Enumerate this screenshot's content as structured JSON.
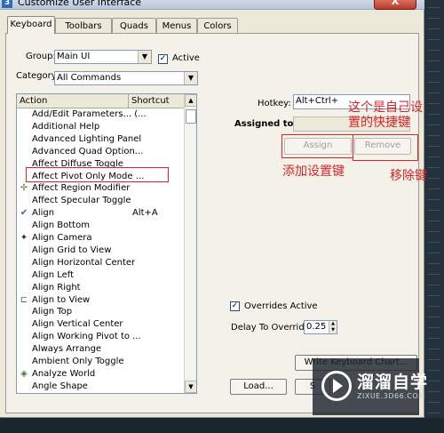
{
  "window": {
    "title": "Customize User Interface",
    "close_label": "X",
    "app_icon": "3ds-max-icon"
  },
  "tabs": [
    {
      "label": "Keyboard",
      "active": true
    },
    {
      "label": "Toolbars",
      "active": false
    },
    {
      "label": "Quads",
      "active": false
    },
    {
      "label": "Menus",
      "active": false
    },
    {
      "label": "Colors",
      "active": false
    }
  ],
  "group": {
    "label": "Group:",
    "value": "Main UI",
    "active_label": "Active",
    "active_checked": true
  },
  "category": {
    "label": "Category:",
    "value": "All Commands"
  },
  "list": {
    "col_action": "Action",
    "col_shortcut": "Shortcut",
    "rows": [
      {
        "name": "Add/Edit Parameters... (...",
        "shortcut": "",
        "icon": ""
      },
      {
        "name": "Additional Help",
        "shortcut": "",
        "icon": ""
      },
      {
        "name": "Advanced Lighting Panel",
        "shortcut": "",
        "icon": ""
      },
      {
        "name": "Advanced Quad Option...",
        "shortcut": "",
        "icon": ""
      },
      {
        "name": "Affect Diffuse Toggle",
        "shortcut": "",
        "icon": ""
      },
      {
        "name": "Affect Pivot Only Mode ...",
        "shortcut": "",
        "icon": ""
      },
      {
        "name": "Affect Region Modifier",
        "shortcut": "",
        "icon": "affect-region-icon"
      },
      {
        "name": "Affect Specular Toggle",
        "shortcut": "",
        "icon": ""
      },
      {
        "name": "Align",
        "shortcut": "Alt+A",
        "icon": "align-icon"
      },
      {
        "name": "Align Bottom",
        "shortcut": "",
        "icon": ""
      },
      {
        "name": "Align Camera",
        "shortcut": "",
        "icon": "align-camera-icon"
      },
      {
        "name": "Align Grid to View",
        "shortcut": "",
        "icon": ""
      },
      {
        "name": "Align Horizontal Center",
        "shortcut": "",
        "icon": ""
      },
      {
        "name": "Align Left",
        "shortcut": "",
        "icon": ""
      },
      {
        "name": "Align Right",
        "shortcut": "",
        "icon": ""
      },
      {
        "name": "Align to View",
        "shortcut": "",
        "icon": "align-to-view-icon"
      },
      {
        "name": "Align Top",
        "shortcut": "",
        "icon": ""
      },
      {
        "name": "Align Vertical Center",
        "shortcut": "",
        "icon": ""
      },
      {
        "name": "Align Working Pivot to ...",
        "shortcut": "",
        "icon": ""
      },
      {
        "name": "Always Arrange",
        "shortcut": "",
        "icon": ""
      },
      {
        "name": "Ambient Only Toggle",
        "shortcut": "",
        "icon": ""
      },
      {
        "name": "Analyze World",
        "shortcut": "",
        "icon": "analyze-world-icon"
      },
      {
        "name": "Angle Shape",
        "shortcut": "",
        "icon": ""
      }
    ]
  },
  "hotkey": {
    "label": "Hotkey:",
    "value": "Alt+Ctrl+"
  },
  "assigned_to": {
    "label": "Assigned to:",
    "value": ""
  },
  "buttons": {
    "assign": "Assign",
    "remove": "Remove",
    "write_chart": "Write Keyboard Chart...",
    "load": "Load...",
    "save_partial": "S"
  },
  "overrides": {
    "label": "Overrides Active",
    "checked": true
  },
  "delay": {
    "label": "Delay To Override:",
    "value": "0.25"
  },
  "annotations": {
    "hotkey_note_line1": "这个是自己设",
    "hotkey_note_line2": "置的快捷键",
    "assign_note": "添加设置键",
    "remove_note": "移除键"
  },
  "watermark": {
    "text": "溜溜自学",
    "url": "ZIXUE.3D66.COM"
  },
  "colors": {
    "annotation_red": "#d8242a",
    "dialog_bg": "#ece9d8",
    "selection_box": "#d8242a"
  }
}
